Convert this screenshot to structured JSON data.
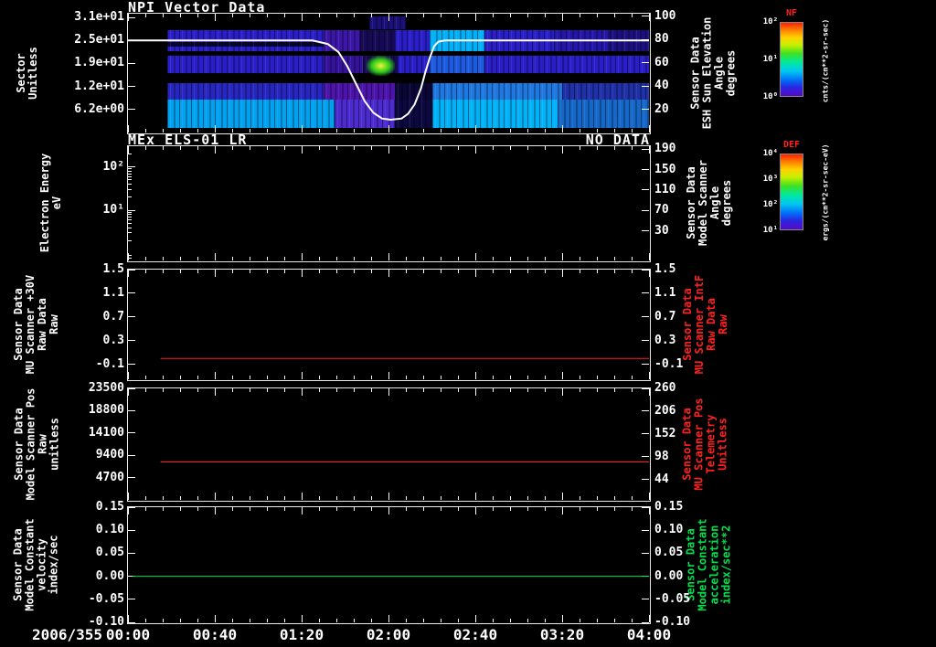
{
  "chart_data": {
    "type": "heatmap",
    "description": "Multi-panel spacecraft sensor time-series plot: NPI spectrogram, empty electron-energy spectrogram, and three flat line plots",
    "time_axis": {
      "date_label": "2006/355",
      "tick_labels": [
        "00:00",
        "00:40",
        "01:20",
        "02:00",
        "02:40",
        "03:20",
        "04:00"
      ],
      "t_start_min": 0,
      "t_end_min": 240
    },
    "panels": [
      {
        "id": "p1",
        "title": "NPI Vector Data",
        "left_axis": {
          "title_lines": [
            "Sector",
            "Unitless"
          ],
          "range": [
            0,
            32
          ],
          "ticks": [
            {
              "v": 31,
              "label": "3.1e+01"
            },
            {
              "v": 24.8,
              "label": "2.5e+01"
            },
            {
              "v": 18.6,
              "label": "1.9e+01"
            },
            {
              "v": 12.4,
              "label": "1.2e+01"
            },
            {
              "v": 6.2,
              "label": "6.2e+00"
            }
          ]
        },
        "right_axis": {
          "title_lines": [
            "Sensor Data",
            "ESH Sun Elevation",
            "Angle",
            "degrees"
          ],
          "range": [
            0,
            102
          ],
          "ticks": [
            {
              "v": 100,
              "label": "100"
            },
            {
              "v": 80,
              "label": "80"
            },
            {
              "v": 60,
              "label": "60"
            },
            {
              "v": 40,
              "label": "40"
            },
            {
              "v": 20,
              "label": "20"
            }
          ]
        },
        "line": {
          "name": "sun-elevation-angle",
          "color": "#ffffff",
          "width": 2,
          "yaxis": "right",
          "points": [
            [
              0,
              79
            ],
            [
              85,
              79
            ],
            [
              92,
              76
            ],
            [
              97,
              69
            ],
            [
              101,
              57
            ],
            [
              105,
              42
            ],
            [
              109,
              27
            ],
            [
              113,
              17
            ],
            [
              117,
              12
            ],
            [
              121,
              11
            ],
            [
              126,
              12
            ],
            [
              129,
              16
            ],
            [
              132,
              24
            ],
            [
              135,
              38
            ],
            [
              137,
              52
            ],
            [
              139,
              64
            ],
            [
              141,
              74
            ],
            [
              143,
              78
            ],
            [
              146,
              79
            ],
            [
              240,
              79
            ]
          ]
        },
        "spectrogram": {
          "bands": [
            {
              "y0": 0.02,
              "y1": 0.13,
              "segments": [
                [
                  111,
                  128,
                  "#1a1078"
                ]
              ]
            },
            {
              "y0": 0.135,
              "y1": 0.315,
              "segments": [
                [
                  18,
                  90,
                  "#2a1ec8"
                ],
                [
                  90,
                  107,
                  "#3c16a6"
                ],
                [
                  107,
                  123,
                  "#160a56"
                ],
                [
                  123,
                  139,
                  "#2a1ec8"
                ],
                [
                  139,
                  164,
                  "#00b0f8"
                ],
                [
                  164,
                  196,
                  "#2a1ec8"
                ],
                [
                  196,
                  222,
                  "#2416a8"
                ],
                [
                  222,
                  240,
                  "#1c1080"
                ]
              ]
            },
            {
              "y0": 0.24,
              "y1": 0.275,
              "segments": [
                [
                  18,
                  90,
                  "#050530"
                ]
              ]
            },
            {
              "y0": 0.35,
              "y1": 0.5,
              "segments": [
                [
                  18,
                  90,
                  "#2a1ec8"
                ],
                [
                  90,
                  108,
                  "#34129c"
                ],
                [
                  108,
                  124,
                  "#140a50"
                ],
                [
                  124,
                  139,
                  "#2a1ec8"
                ],
                [
                  139,
                  164,
                  "#1e5ae0"
                ],
                [
                  164,
                  240,
                  "#2a1ec8"
                ]
              ]
            },
            {
              "y0": 0.585,
              "y1": 0.72,
              "segments": [
                [
                  18,
                  90,
                  "#2826c0"
                ],
                [
                  90,
                  123,
                  "#4c14aa"
                ],
                [
                  123,
                  140,
                  "#0a0636"
                ],
                [
                  140,
                  200,
                  "#1e78e0"
                ],
                [
                  200,
                  240,
                  "#2030a8"
                ]
              ]
            },
            {
              "y0": 0.72,
              "y1": 0.965,
              "segments": [
                [
                  18,
                  95,
                  "#00a2f0"
                ],
                [
                  95,
                  123,
                  "#4c2cd0"
                ],
                [
                  123,
                  140,
                  "#0c0840"
                ],
                [
                  140,
                  198,
                  "#00b2f8"
                ],
                [
                  198,
                  240,
                  "#1668c8"
                ]
              ]
            }
          ],
          "blob": {
            "t0": 110,
            "t1": 123,
            "y0": 0.35,
            "y1": 0.52,
            "inner": "#e8f838",
            "outer": "#2cc818"
          }
        }
      },
      {
        "id": "p2",
        "title": "MEx ELS-01 LR",
        "corner_note": "NO DATA",
        "left_axis": {
          "title_lines": [
            "Electron Energy",
            "eV"
          ],
          "scale": "log",
          "range": [
            0.7,
            300
          ],
          "ticks": [
            {
              "v": 100,
              "label": "10²"
            },
            {
              "v": 10,
              "label": "10¹"
            }
          ]
        },
        "right_axis": {
          "title_lines": [
            "Sensor Data",
            "Model Scanner",
            "Angle",
            "degrees"
          ],
          "range": [
            -28,
            196
          ],
          "ticks": [
            {
              "v": 190,
              "label": "190"
            },
            {
              "v": 150,
              "label": "150"
            },
            {
              "v": 110,
              "label": "110"
            },
            {
              "v": 70,
              "label": "70"
            },
            {
              "v": 30,
              "label": "30"
            }
          ]
        }
      },
      {
        "id": "p3",
        "title": "",
        "left_axis": {
          "title_lines": [
            "Sensor Data",
            "MU Scanner +30V",
            "Raw Data",
            "Raw"
          ],
          "range": [
            -0.35,
            1.5
          ],
          "ticks": [
            {
              "v": 1.5,
              "label": "1.5"
            },
            {
              "v": 1.1,
              "label": "1.1"
            },
            {
              "v": 0.7,
              "label": "0.7"
            },
            {
              "v": 0.3,
              "label": "0.3"
            },
            {
              "v": -0.1,
              "label": "-0.1"
            }
          ]
        },
        "right_axis": {
          "title_lines": [
            "Sensor Data",
            "MU Scanner IntF",
            "Raw Data",
            "Raw"
          ],
          "color_class": "red",
          "range": [
            -0.35,
            1.5
          ],
          "ticks": [
            {
              "v": 1.5,
              "label": "1.5"
            },
            {
              "v": 1.1,
              "label": "1.1"
            },
            {
              "v": 0.7,
              "label": "0.7"
            },
            {
              "v": 0.3,
              "label": "0.3"
            },
            {
              "v": -0.1,
              "label": "-0.1"
            }
          ]
        },
        "line": {
          "name": "mu-scanner-raw",
          "color": "#ff2020",
          "width": 1,
          "yaxis": "left",
          "points": [
            [
              15,
              0.0
            ],
            [
              240,
              0.0
            ]
          ]
        }
      },
      {
        "id": "p4",
        "title": "",
        "left_axis": {
          "title_lines": [
            "Sensor Data",
            "Model Scanner Pos",
            "Raw",
            "unitless"
          ],
          "range": [
            0,
            23500
          ],
          "ticks": [
            {
              "v": 23500,
              "label": "23500"
            },
            {
              "v": 18800,
              "label": "18800"
            },
            {
              "v": 14100,
              "label": "14100"
            },
            {
              "v": 9400,
              "label": "9400"
            },
            {
              "v": 4700,
              "label": "4700"
            }
          ]
        },
        "right_axis": {
          "title_lines": [
            "Sensor Data",
            "MU Scanner Pos",
            "Telemetry",
            "Unitless"
          ],
          "color_class": "red",
          "range": [
            -4,
            260
          ],
          "ticks": [
            {
              "v": 260,
              "label": "260"
            },
            {
              "v": 206,
              "label": "206"
            },
            {
              "v": 152,
              "label": "152"
            },
            {
              "v": 98,
              "label": "98"
            },
            {
              "v": 44,
              "label": "44"
            }
          ]
        },
        "line": {
          "name": "model-scanner-pos",
          "color": "#ff2020",
          "width": 1,
          "yaxis": "left",
          "points": [
            [
              15,
              8000
            ],
            [
              240,
              8000
            ]
          ]
        }
      },
      {
        "id": "p5",
        "title": "",
        "left_axis": {
          "title_lines": [
            "Sensor Data",
            "Model Constant",
            "velocity",
            "index/sec"
          ],
          "range": [
            -0.1,
            0.15
          ],
          "ticks": [
            {
              "v": 0.15,
              "label": "0.15"
            },
            {
              "v": 0.1,
              "label": "0.10"
            },
            {
              "v": 0.05,
              "label": "0.05"
            },
            {
              "v": 0.0,
              "label": "0.00"
            },
            {
              "v": -0.05,
              "label": "-0.05"
            },
            {
              "v": -0.1,
              "label": "-0.10"
            }
          ]
        },
        "right_axis": {
          "title_lines": [
            "Sensor Data",
            "Model Constant",
            "acceleration",
            "index/sec**2"
          ],
          "color_class": "green",
          "range": [
            -0.1,
            0.15
          ],
          "ticks": [
            {
              "v": 0.15,
              "label": "0.15"
            },
            {
              "v": 0.1,
              "label": "0.10"
            },
            {
              "v": 0.05,
              "label": "0.05"
            },
            {
              "v": 0.0,
              "label": "0.00"
            },
            {
              "v": -0.05,
              "label": "-0.05"
            },
            {
              "v": -0.1,
              "label": "-0.10"
            }
          ]
        },
        "line": {
          "name": "model-constant-velocity",
          "color": "#00e050",
          "width": 1,
          "yaxis": "left",
          "points": [
            [
              2,
              0.0
            ],
            [
              240,
              0.0
            ]
          ]
        }
      }
    ],
    "colorbars": [
      {
        "id": "nf",
        "title": "NF",
        "tick_labels": [
          "10²",
          "10¹",
          "10⁰"
        ],
        "unit": "cnts/(cm**2-sr-sec)"
      },
      {
        "id": "def",
        "title": "DEF",
        "tick_labels": [
          "10⁴",
          "10³",
          "10²",
          "10¹"
        ],
        "unit": "ergs/(cm**2-sr-sec-eV)"
      }
    ],
    "colors": {
      "accent_red": "#ff2020",
      "accent_green": "#00e050",
      "foreground": "#ffffff",
      "background": "#000000"
    }
  }
}
